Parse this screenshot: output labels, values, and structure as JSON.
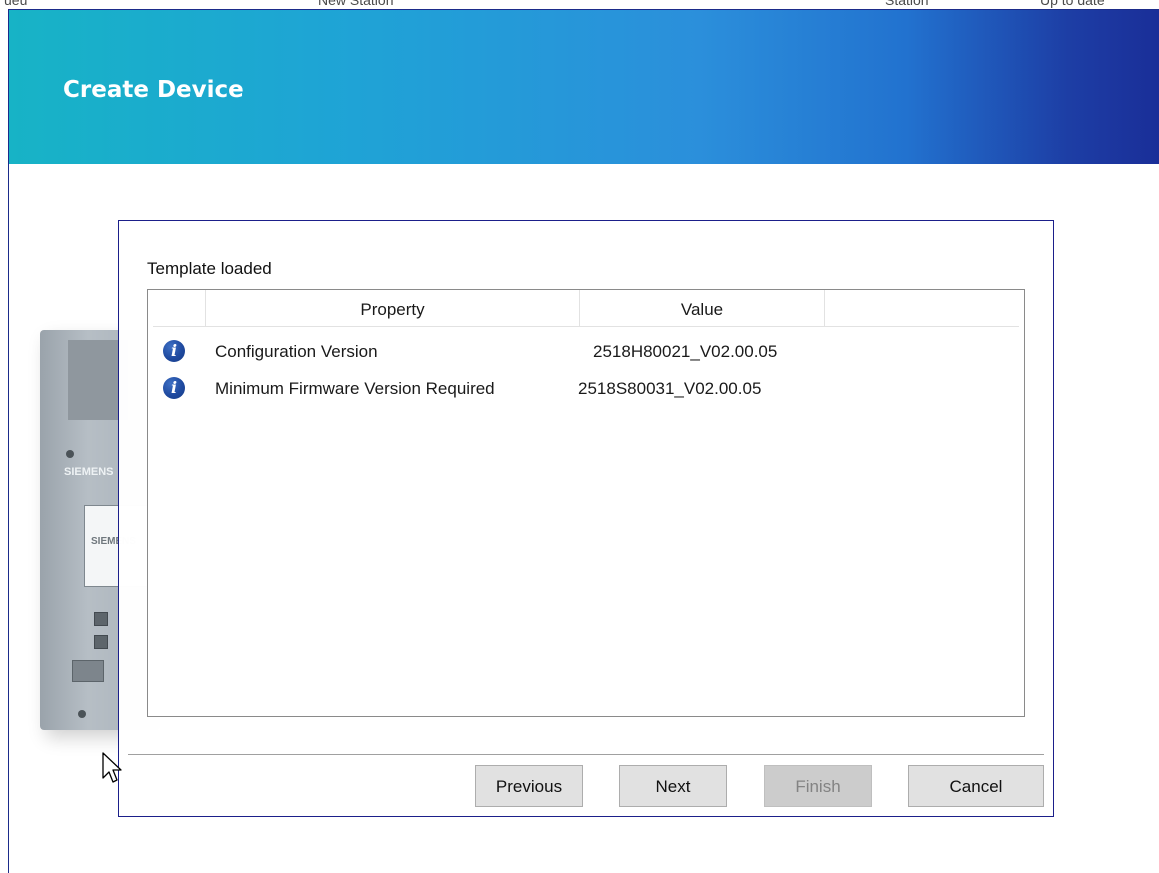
{
  "background_window": {
    "fragments": [
      "ueu",
      "New Station",
      "Station",
      "Up to date"
    ]
  },
  "banner": {
    "title": "Create Device"
  },
  "device_image": {
    "brand_text": "SIEMENS",
    "screen_text": "SIEMENS"
  },
  "dialog": {
    "status_label": "Template loaded",
    "table": {
      "columns": [
        "Property",
        "Value"
      ],
      "rows": [
        {
          "icon": "info-icon",
          "property": "Configuration Version",
          "value": "2518H80021_V02.00.05"
        },
        {
          "icon": "info-icon",
          "property": "Minimum Firmware Version Required",
          "value": "2518S80031_V02.00.05"
        }
      ]
    },
    "buttons": {
      "previous": "Previous",
      "next": "Next",
      "finish": "Finish",
      "cancel": "Cancel"
    }
  },
  "colors": {
    "banner_start": "#17b3c6",
    "banner_end": "#1a2e98",
    "dialog_border": "#1b1f8a",
    "info_icon": "#1f4aa0"
  }
}
